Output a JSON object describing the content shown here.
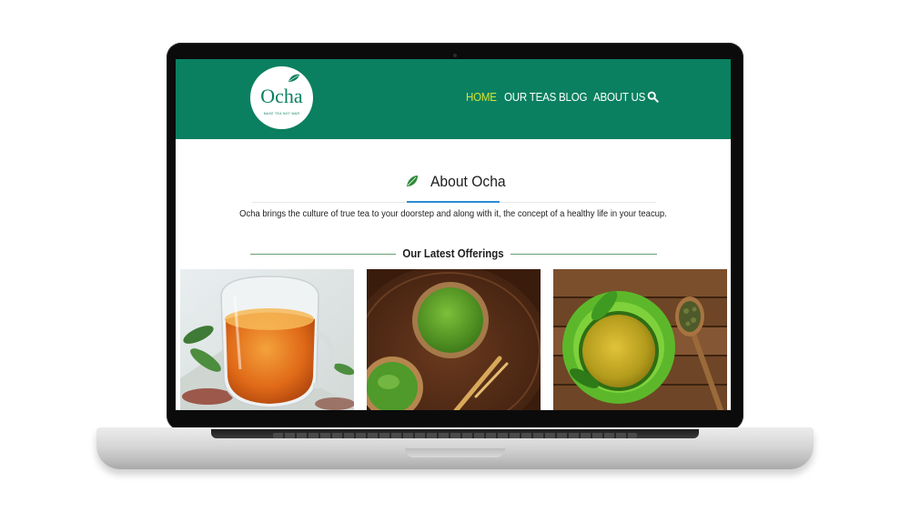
{
  "site": {
    "logo_text": "Ocha",
    "logo_tagline": "MAKE TEA NOT WAR",
    "nav": [
      "HOME",
      "OUR TEAS",
      "BLOG",
      "ABOUT US"
    ],
    "active_nav": "HOME"
  },
  "about": {
    "title": "About Ocha",
    "text": "Ocha brings the culture of true tea to your doorstep and along with it, the concept of a healthy life in your teacup."
  },
  "offerings": {
    "title": "Our Latest Offerings",
    "cards": [
      "black-tea-glass-cup",
      "matcha-powder-bowls",
      "green-tea-cup-wooden-table"
    ]
  },
  "colors": {
    "header": "#0a8060",
    "active_nav": "#d8e234",
    "underline": "#2d8bd4",
    "leaf": "#2e8b3a"
  },
  "icons": [
    "leaf-icon",
    "search-icon"
  ]
}
